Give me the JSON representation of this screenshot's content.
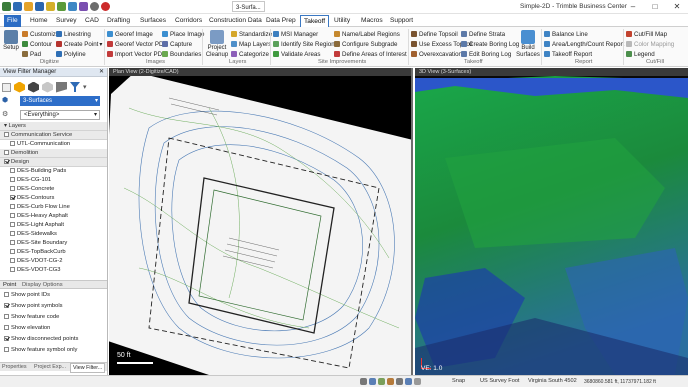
{
  "window": {
    "title": "Simple-2D - Trimble Business Center"
  },
  "menu": {
    "tabs": [
      "File",
      "Home",
      "Survey",
      "CAD",
      "Drafting",
      "Surfaces",
      "Corridors",
      "Construction Data",
      "Data Prep",
      "Takeoff",
      "Utility",
      "Macros",
      "Support"
    ],
    "active": "Takeoff"
  },
  "view_tab": "3-Surfa...",
  "ribbon": {
    "setup": "Setup",
    "digitize": [
      "Customize",
      "Contour",
      "Pad"
    ],
    "digitize2": [
      "Linestring",
      "Create Point",
      "Polyline"
    ],
    "images": [
      "Georef Image",
      "Georef Vector PDF",
      "Import Vector PDF"
    ],
    "images2": [
      "Place Image",
      "Capture",
      "Boundaries"
    ],
    "project_cleanup": "Project Cleanup",
    "layers": [
      "Standardize",
      "Map Layers",
      "Categorize"
    ],
    "site": [
      "MSI Manager",
      "Identify Site Regions",
      "Validate Areas"
    ],
    "site2": [
      "Name/Label Regions",
      "Configure Subgrade",
      "Define Areas of Interest"
    ],
    "takeoff": [
      "Define Topsoil",
      "Use Excess Topsoil",
      "Overexcavation"
    ],
    "takeoff2": [
      "Define Strata",
      "Create Boring Log",
      "Edit Boring Log"
    ],
    "build_surfaces": "Build Surfaces",
    "report": [
      "Balance Line",
      "Area/Length/Count Report",
      "Takeoff Report"
    ],
    "cutfill": [
      "Cut/Fill Map",
      "Color Mapping",
      "Legend"
    ],
    "groups": [
      "Digitize",
      "Images",
      "Layers",
      "Site Improvements",
      "Takeoff",
      "Report",
      "Cut/Fill"
    ]
  },
  "left_panel": {
    "title": "View Filter Manager",
    "surface_select": "3-Surfaces",
    "filter_select": "<Everything>",
    "layers_header": "Layers",
    "layers": [
      {
        "label": "Communication Service",
        "checked": false,
        "header": true
      },
      {
        "label": "UTL-Communication",
        "checked": false,
        "header": false
      },
      {
        "label": "Demolition",
        "checked": false,
        "header": true
      },
      {
        "label": "Design",
        "checked": true,
        "header": true
      },
      {
        "label": "DES-Building Pads",
        "checked": false,
        "header": false
      },
      {
        "label": "DES-CG-101",
        "checked": false,
        "header": false
      },
      {
        "label": "DES-Concrete",
        "checked": false,
        "header": false
      },
      {
        "label": "DES-Contours",
        "checked": true,
        "header": false
      },
      {
        "label": "DES-Curb Flow Line",
        "checked": false,
        "header": false
      },
      {
        "label": "DES-Heavy Asphalt",
        "checked": false,
        "header": false
      },
      {
        "label": "DES-Light Asphalt",
        "checked": false,
        "header": false
      },
      {
        "label": "DES-Sidewalks",
        "checked": false,
        "header": false
      },
      {
        "label": "DES-Site Boundary",
        "checked": false,
        "header": false
      },
      {
        "label": "DES-TopBackCurb",
        "checked": false,
        "header": false
      },
      {
        "label": "DES-VDOT-CG-2",
        "checked": false,
        "header": false
      },
      {
        "label": "DES-VDOT-CG3",
        "checked": false,
        "header": false
      }
    ],
    "tabs": [
      "Point",
      "Display Options"
    ],
    "options": [
      {
        "label": "Show point IDs",
        "checked": false
      },
      {
        "label": "Show point symbols",
        "checked": true
      },
      {
        "label": "Show feature code",
        "checked": false
      },
      {
        "label": "Show elevation",
        "checked": false
      },
      {
        "label": "Show disconnected points",
        "checked": true
      },
      {
        "label": "Show feature symbol only",
        "checked": false
      }
    ],
    "bottom_tabs": [
      "Properties",
      "Project Exp...",
      "View Filter..."
    ]
  },
  "plan_view": {
    "title": "Plan View (2-Digitize/CAD)",
    "scale": "50 ft"
  },
  "view3d": {
    "title": "3D View (3-Surfaces)",
    "ve": "VE: 1.0"
  },
  "status": {
    "snap": "Snap",
    "units": "US Survey Foot",
    "zone": "Virginia South 4502",
    "coords": "3680860.581 ft, 11737971.182 ft"
  }
}
